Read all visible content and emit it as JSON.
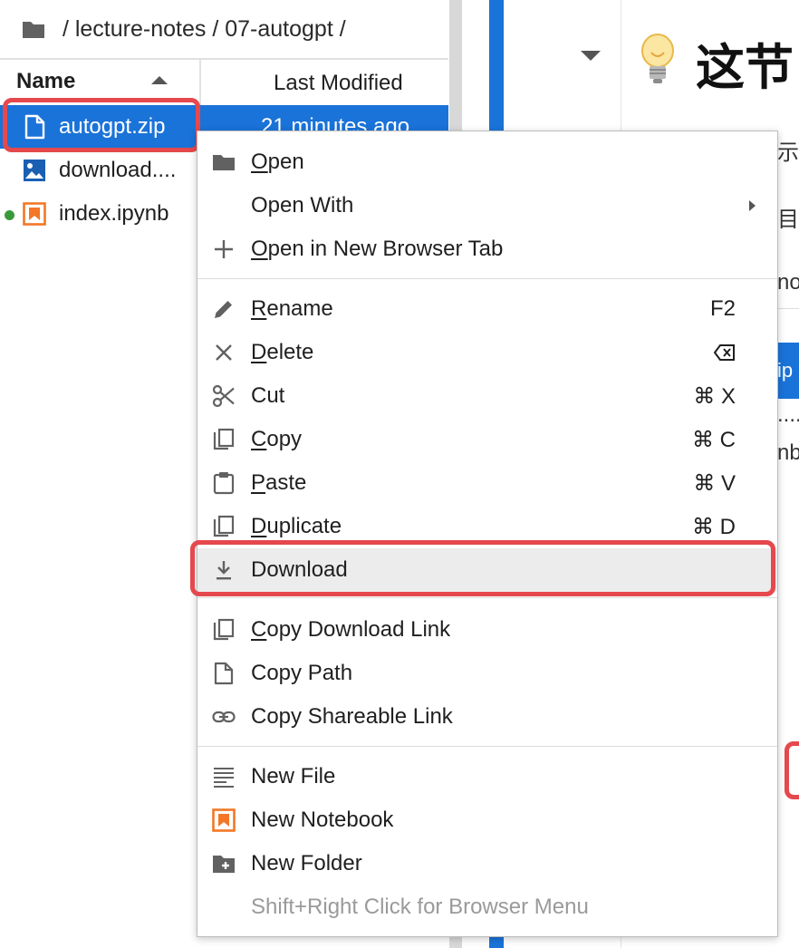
{
  "breadcrumb": {
    "separator_1": " / ",
    "segment_1": "lecture-notes",
    "separator_2": " / ",
    "segment_2": "07-autogpt",
    "separator_3": " /"
  },
  "file_browser": {
    "column_name": "Name",
    "column_modified": "Last Modified",
    "files": [
      {
        "name": "autogpt.zip",
        "modified": "21 minutes ago",
        "icon": "file-icon",
        "selected": true
      },
      {
        "name": "download....",
        "icon": "image-icon"
      },
      {
        "name": "index.ipynb",
        "icon": "notebook-icon",
        "running": true
      }
    ]
  },
  "notebook_preview": {
    "title": "这节",
    "snippet_1": "示",
    "snippet_2": "目",
    "snippet_3": "no",
    "snippet_4": "ip",
    "snippet_5": "....",
    "snippet_6": "nb"
  },
  "context_menu": {
    "open": {
      "first": "O",
      "rest": "pen"
    },
    "open_with": "Open With",
    "open_new_tab": {
      "first": "O",
      "rest": "pen in New Browser Tab"
    },
    "rename": {
      "first": "R",
      "rest": "ename",
      "shortcut": "F2"
    },
    "delete": {
      "first": "D",
      "rest": "elete"
    },
    "cut": {
      "label": "Cut",
      "shortcut": "⌘ X"
    },
    "copy": {
      "first": "C",
      "rest": "opy",
      "shortcut": "⌘ C"
    },
    "paste": {
      "first": "P",
      "rest": "aste",
      "shortcut": "⌘ V"
    },
    "duplicate": {
      "first": "D",
      "rest": "uplicate",
      "shortcut": "⌘ D"
    },
    "download": "Download",
    "copy_download_link": {
      "first": "C",
      "rest": "opy Download Link"
    },
    "copy_path": "Copy Path",
    "copy_shareable_link": "Copy Shareable Link",
    "new_file": "New File",
    "new_notebook": "New Notebook",
    "new_folder": "New Folder",
    "browser_menu_hint": "Shift+Right Click for Browser Menu"
  },
  "colors": {
    "accent_blue": "#1a73d8",
    "highlight_red": "#e5484d",
    "notebook_orange": "#f37726",
    "running_green": "#3a9a3a"
  }
}
